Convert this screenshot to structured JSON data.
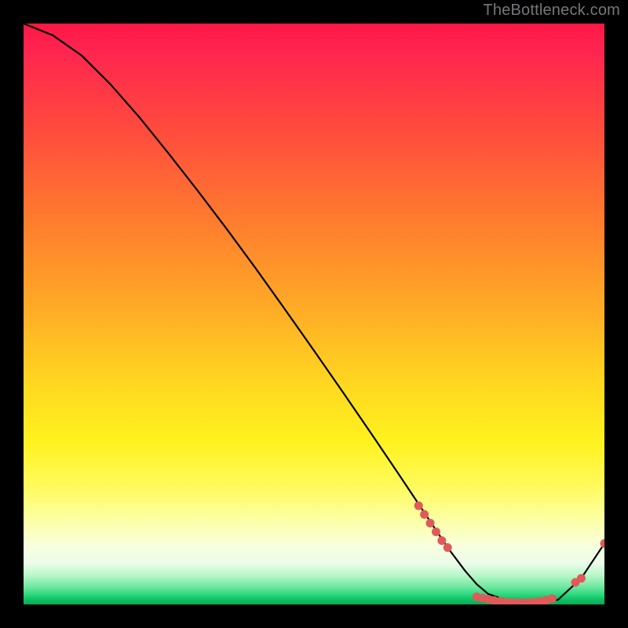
{
  "attribution": "TheBottleneck.com",
  "colors": {
    "dot": "#e05a5a",
    "line": "#000000",
    "bg_top": "#ff1744",
    "bg_bottom": "#0aa956"
  },
  "chart_data": {
    "type": "line",
    "title": "",
    "xlabel": "",
    "ylabel": "",
    "xlim": [
      0,
      100
    ],
    "ylim": [
      0,
      100
    ],
    "grid": false,
    "series": [
      {
        "name": "bottleneck-curve",
        "x": [
          0,
          5,
          10,
          15,
          20,
          25,
          30,
          35,
          40,
          45,
          50,
          55,
          60,
          65,
          70,
          73,
          76,
          78,
          80,
          84,
          88,
          92,
          96,
          100
        ],
        "values": [
          100,
          98,
          94.5,
          89.5,
          83.8,
          77.6,
          71.2,
          64.6,
          57.8,
          50.8,
          43.7,
          36.5,
          29.2,
          21.8,
          14.3,
          9.8,
          5.8,
          3.5,
          1.8,
          0.4,
          0.2,
          0.8,
          4.5,
          10.5
        ]
      }
    ],
    "dot_clusters": [
      {
        "name": "descent-cluster",
        "points_x": [
          68,
          69,
          70,
          71,
          72,
          73
        ],
        "points_y": [
          17,
          15.5,
          14,
          12.5,
          11,
          9.8
        ]
      },
      {
        "name": "valley-cluster",
        "points_x": [
          78,
          79,
          80,
          81,
          82,
          83,
          84,
          85,
          86,
          87,
          88,
          89,
          90,
          91
        ],
        "points_y": [
          1.3,
          1.1,
          0.9,
          0.7,
          0.55,
          0.4,
          0.35,
          0.3,
          0.3,
          0.35,
          0.4,
          0.55,
          0.75,
          1.0
        ]
      },
      {
        "name": "rise-cluster",
        "points_x": [
          95,
          96,
          100
        ],
        "points_y": [
          3.8,
          4.5,
          10.5
        ]
      }
    ]
  }
}
